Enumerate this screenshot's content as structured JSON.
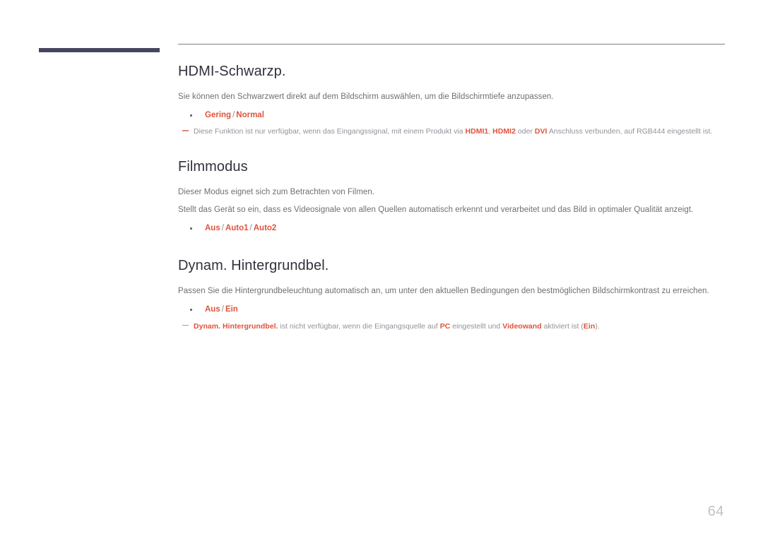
{
  "document": {
    "page_number": "64",
    "accent_color": "#e0533b",
    "heading_color": "#33303c",
    "body_color": "#6f6e73",
    "note_color": "#93929a",
    "chapter_bar_color": "#474660"
  },
  "sections": [
    {
      "title": "HDMI-Schwarzp.",
      "paragraphs": [
        "Sie können den Schwarzwert direkt auf dem Bildschirm auswählen, um die Bildschirmtiefe anzupassen."
      ],
      "options": [
        {
          "parts": [
            "Gering",
            "Normal"
          ]
        }
      ],
      "notes": [
        {
          "segments": [
            {
              "text": "Diese Funktion ist nur verfügbar, wenn das Eingangssignal, mit einem Produkt via ",
              "style": "plain"
            },
            {
              "text": "HDMI1",
              "style": "highlight"
            },
            {
              "text": ", ",
              "style": "plain"
            },
            {
              "text": "HDMI2",
              "style": "highlight"
            },
            {
              "text": " oder ",
              "style": "plain"
            },
            {
              "text": "DVI",
              "style": "highlight"
            },
            {
              "text": " Anschluss verbunden, auf RGB444 eingestellt ist.",
              "style": "plain"
            }
          ]
        }
      ]
    },
    {
      "title": "Filmmodus",
      "paragraphs": [
        "Dieser Modus eignet sich zum Betrachten von Filmen.",
        "Stellt das Gerät so ein, dass es Videosignale von allen Quellen automatisch erkennt und verarbeitet und das Bild in optimaler Qualität anzeigt."
      ],
      "options": [
        {
          "parts": [
            "Aus",
            "Auto1",
            "Auto2"
          ]
        }
      ],
      "notes": []
    },
    {
      "title": "Dynam. Hintergrundbel.",
      "paragraphs": [
        "Passen Sie die Hintergrundbeleuchtung automatisch an, um unter den aktuellen Bedingungen den bestmöglichen Bildschirmkontrast zu erreichen."
      ],
      "options": [
        {
          "parts": [
            "Aus",
            "Ein"
          ]
        }
      ],
      "notes": [
        {
          "segments": [
            {
              "text": "Dynam. Hintergrundbel.",
              "style": "highlight"
            },
            {
              "text": " ist nicht verfügbar, wenn die Eingangsquelle auf ",
              "style": "plain"
            },
            {
              "text": "PC",
              "style": "highlight"
            },
            {
              "text": " eingestellt und ",
              "style": "plain"
            },
            {
              "text": "Videowand",
              "style": "highlight"
            },
            {
              "text": " aktiviert ist (",
              "style": "plain"
            },
            {
              "text": "Ein",
              "style": "highlight"
            },
            {
              "text": ").",
              "style": "plain"
            }
          ]
        }
      ]
    }
  ]
}
